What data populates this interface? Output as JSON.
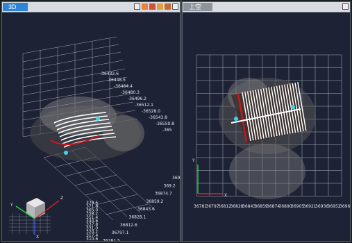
{
  "left_panel": {
    "tab": "3D",
    "toolbar_icons": [
      "minimize-icon",
      "view-front-icon",
      "view-side-icon",
      "view-top-icon",
      "view-iso-icon",
      "close-icon"
    ],
    "coord_labels": [
      "-36432.6",
      "-36448.5",
      "-36464.4",
      "-36480.3",
      "-36496.2",
      "-36512.1",
      "-36528.0",
      "-36543.8",
      "-36559.8",
      "-365"
    ],
    "coord_labels_lower": [
      "369",
      "369.2",
      "36874.7",
      "36859.2",
      "36843.6",
      "36828.1",
      "36812.6",
      "36797.1",
      "36781.5"
    ],
    "z_labels": [
      "378.6",
      "371.8",
      "365.0",
      "358.2",
      "351.4",
      "344.6",
      "337.8",
      "331.0",
      "324.2",
      "317.4",
      "310.6"
    ],
    "axis_labels": {
      "y": "Y",
      "z": "Z",
      "x": "X"
    }
  },
  "right_panel": {
    "tab": "上空",
    "toolbar_icons": [
      "minimize-icon"
    ],
    "axis_labels": {
      "y": "Y",
      "x": "X"
    },
    "x_tick_labels": [
      "36781",
      "36797",
      "36812",
      "36828",
      "36843",
      "36859",
      "36874",
      "36890",
      "36905",
      "36921",
      "36936",
      "36952",
      "36967"
    ]
  },
  "colors": {
    "background": "#1e2235",
    "grid": "#c8ccd6",
    "track_red": "#c8161e",
    "marker_cyan": "#3ed6e6"
  }
}
